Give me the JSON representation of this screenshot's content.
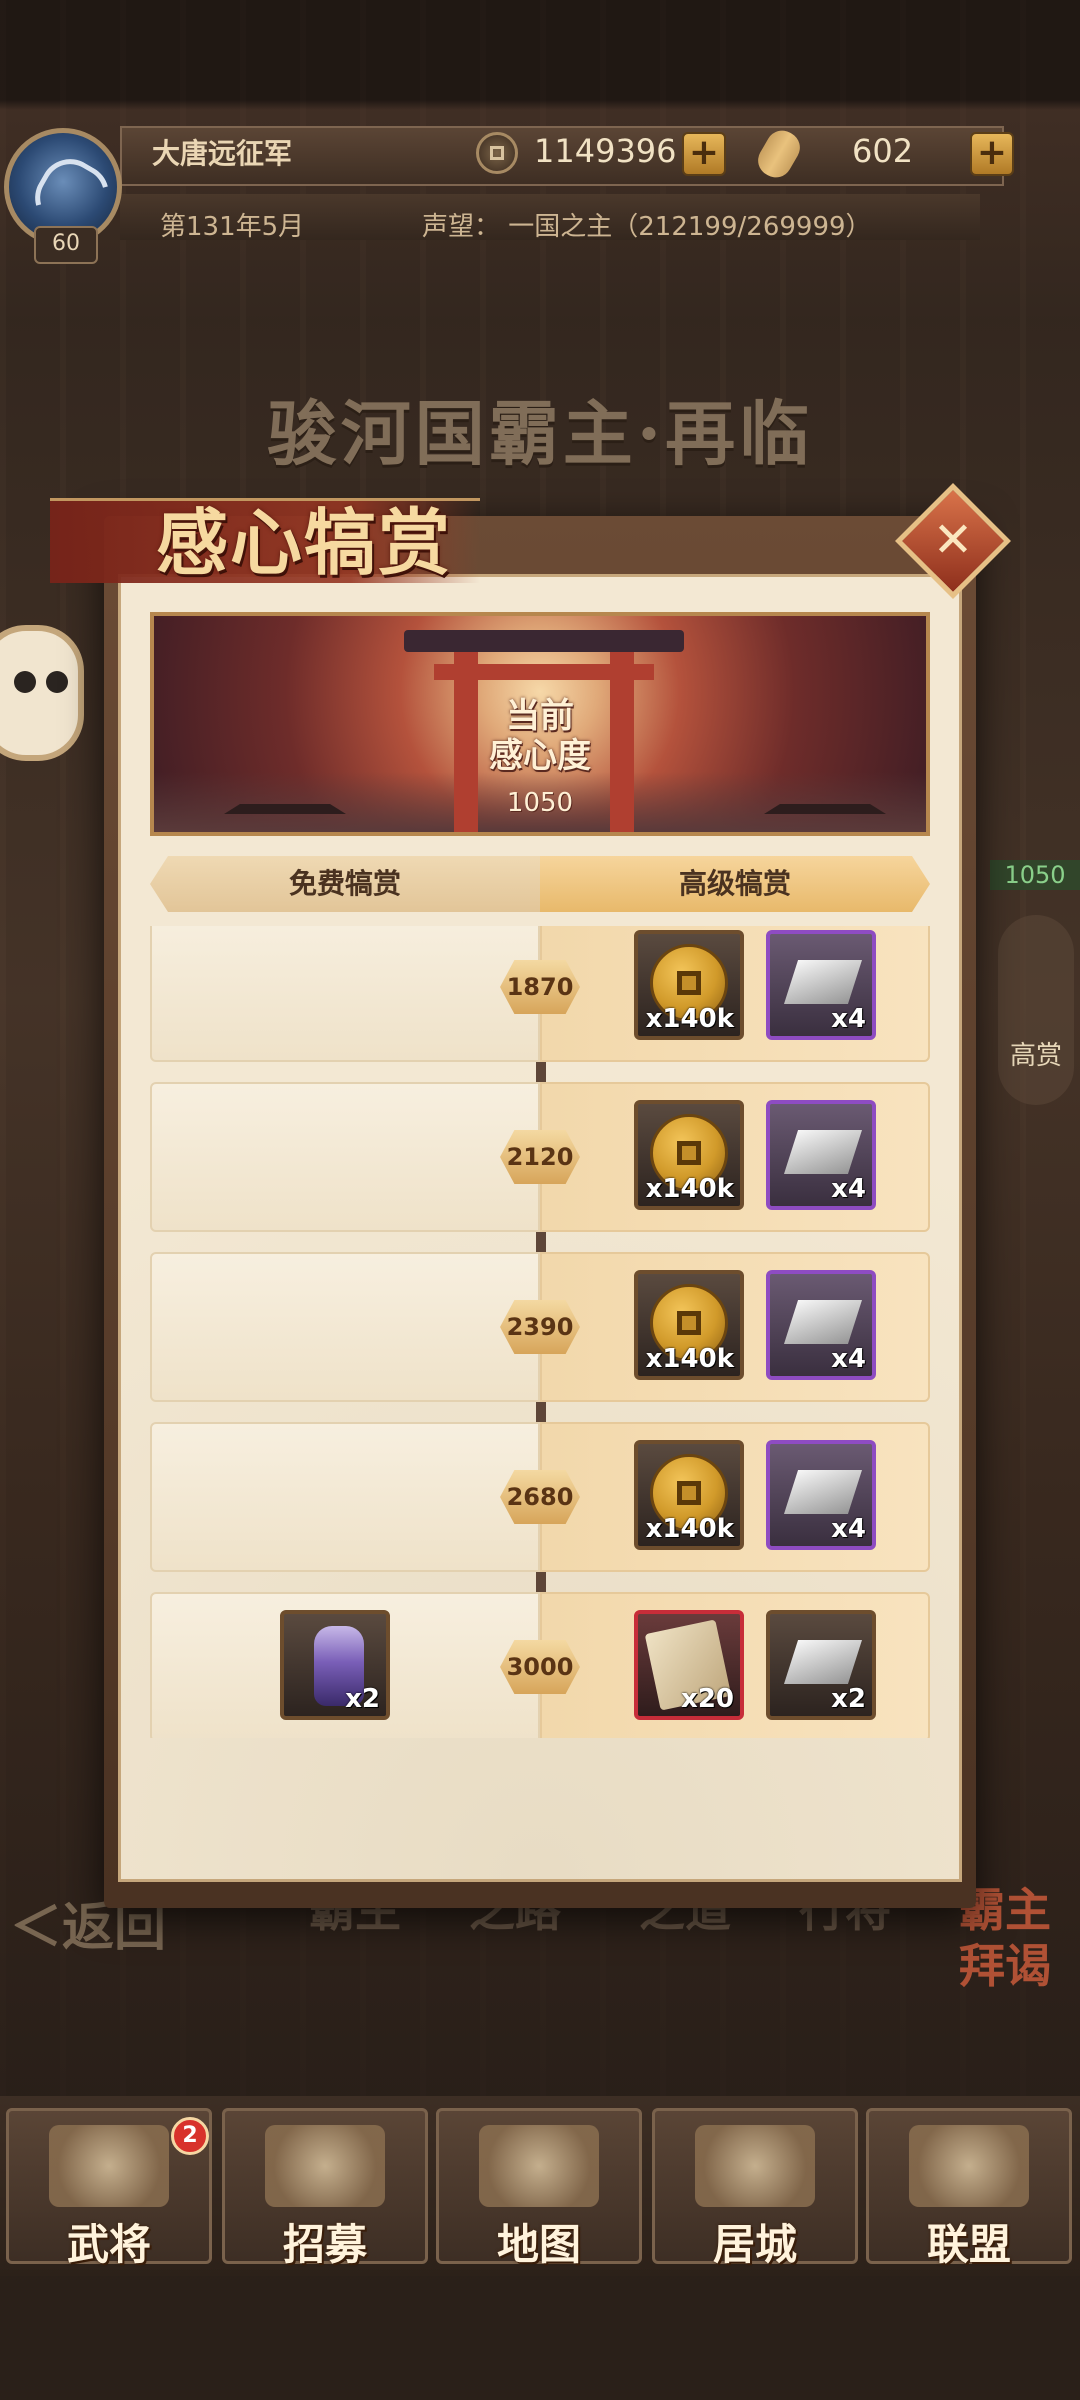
{
  "header": {
    "player_name": "大唐远征军",
    "level": "60",
    "coins": "1149396",
    "gems": "602",
    "date": "第131年5月",
    "prestige": "声望： 一国之主（212199/269999）"
  },
  "background": {
    "stage_title": "骏河国霸主·再临",
    "back_label": "＜返回",
    "menu_items": [
      "霸主",
      "之路",
      "之道",
      "行将",
      "霸主拜谒"
    ],
    "side_value": "1050",
    "side_label": "高赏"
  },
  "modal": {
    "title": "感心犒赏",
    "close_icon": "✕",
    "banner": {
      "label_line1": "当前",
      "label_line2": "感心度",
      "value": "1050"
    },
    "tabs": {
      "free": "免费犒赏",
      "premium": "高级犒赏"
    },
    "rows": [
      {
        "threshold": "1870",
        "free_rewards": [],
        "premium_rewards": [
          {
            "icon": "coin-icon",
            "qty": "x140k",
            "rarity": "gold"
          },
          {
            "icon": "silver-ingot-icon",
            "qty": "x4",
            "rarity": "purple"
          }
        ]
      },
      {
        "threshold": "2120",
        "free_rewards": [],
        "premium_rewards": [
          {
            "icon": "coin-icon",
            "qty": "x140k",
            "rarity": "gold"
          },
          {
            "icon": "silver-ingot-icon",
            "qty": "x4",
            "rarity": "purple"
          }
        ]
      },
      {
        "threshold": "2390",
        "free_rewards": [],
        "premium_rewards": [
          {
            "icon": "coin-icon",
            "qty": "x140k",
            "rarity": "gold"
          },
          {
            "icon": "silver-ingot-icon",
            "qty": "x4",
            "rarity": "purple"
          }
        ]
      },
      {
        "threshold": "2680",
        "free_rewards": [],
        "premium_rewards": [
          {
            "icon": "coin-icon",
            "qty": "x140k",
            "rarity": "gold"
          },
          {
            "icon": "silver-ingot-icon",
            "qty": "x4",
            "rarity": "purple"
          }
        ]
      },
      {
        "threshold": "3000",
        "free_rewards": [
          {
            "icon": "purple-bottle-icon",
            "qty": "x2",
            "rarity": "gold"
          }
        ],
        "premium_rewards": [
          {
            "icon": "scroll-icon",
            "qty": "x20",
            "rarity": "red"
          },
          {
            "icon": "silver-ingot-icon",
            "qty": "x2",
            "rarity": "gold"
          }
        ]
      }
    ]
  },
  "bottom_nav": [
    {
      "label": "武将",
      "icon": "general-helmet-icon",
      "badge": "2"
    },
    {
      "label": "招募",
      "icon": "recruit-sword-icon",
      "badge": ""
    },
    {
      "label": "地图",
      "icon": "map-scroll-icon",
      "badge": ""
    },
    {
      "label": "居城",
      "icon": "castle-icon",
      "badge": ""
    },
    {
      "label": "联盟",
      "icon": "alliance-fans-icon",
      "badge": ""
    }
  ],
  "colors": {
    "accent_gold": "#e7b75a",
    "modal_red": "#8e2f1c",
    "rarity_purple": "#8e4cc2",
    "rarity_red": "#c72d39",
    "badge_red": "#d8322b"
  }
}
